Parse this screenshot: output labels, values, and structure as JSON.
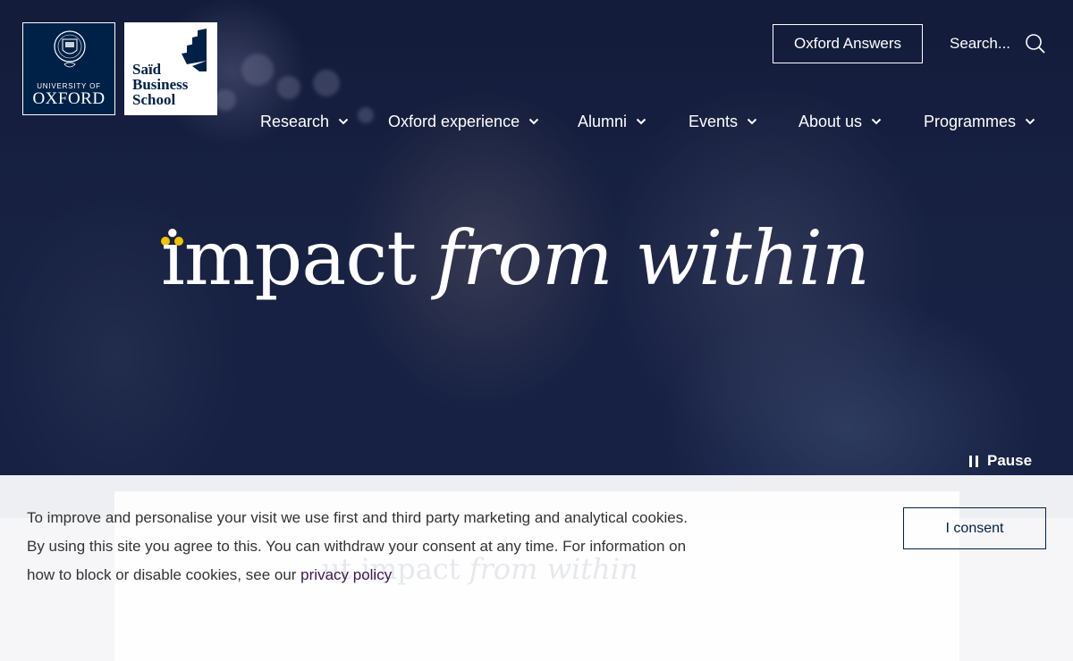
{
  "logos": {
    "oxford": {
      "line1": "UNIVERSITY OF",
      "line2": "OXFORD"
    },
    "said": {
      "line1": "Saïd",
      "line2": "Business",
      "line3": "School"
    }
  },
  "header": {
    "answers_label": "Oxford Answers",
    "search_label": "Search...",
    "search_icon": "search-icon"
  },
  "nav": {
    "items": [
      {
        "label": "Research"
      },
      {
        "label": "Oxford experience"
      },
      {
        "label": "Alumni"
      },
      {
        "label": "Events"
      },
      {
        "label": "About us"
      },
      {
        "label": "Programmes"
      }
    ]
  },
  "hero": {
    "headline_part1": "impact",
    "headline_part2": "from within",
    "pause_label": "Pause",
    "accent_color": "#f2c300"
  },
  "cookie": {
    "text": "To improve and personalise your visit we use first and third party marketing and analytical cookies. By using this site you agree to this. You can withdraw your consent at any time. For information on how to block or disable cookies, see our ",
    "link_text": "privacy policy",
    "consent_label": "I consent",
    "ghost_text_1": "ut impact",
    "ghost_text_2": "from within"
  },
  "colors": {
    "navy": "#002147",
    "link": "#3d1a4d"
  }
}
